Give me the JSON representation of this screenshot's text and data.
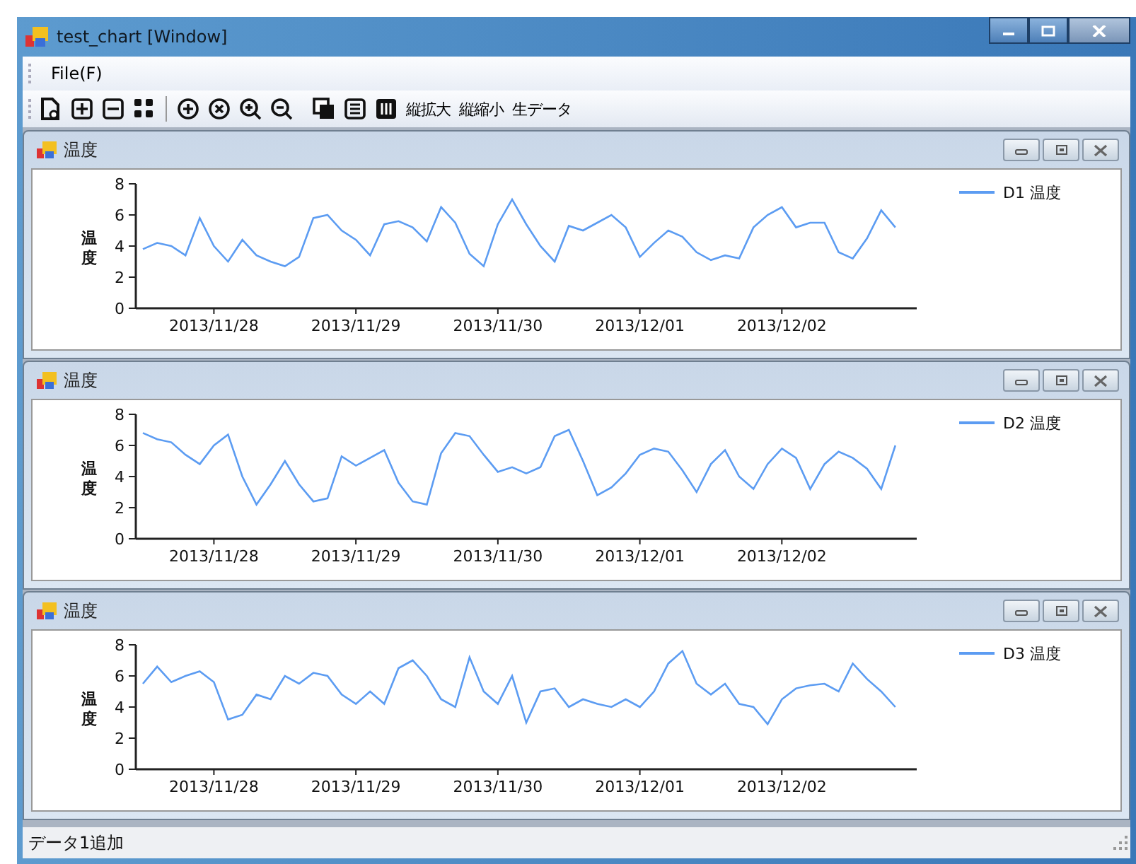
{
  "window": {
    "title": "test_chart [Window]"
  },
  "menu": [
    "File(F)"
  ],
  "toolbar": {
    "text_buttons": [
      "縦拡大",
      "縦縮小",
      "生データ"
    ]
  },
  "panels": [
    {
      "title": "温度",
      "chart_data": {
        "type": "line",
        "ylabel": "温度",
        "ylim": [
          0,
          8
        ],
        "yticks": [
          0,
          2,
          4,
          6,
          8
        ],
        "categories": [
          null,
          null,
          null,
          null,
          null,
          "2013/11/28",
          null,
          null,
          null,
          null,
          null,
          null,
          null,
          null,
          null,
          "2013/11/29",
          null,
          null,
          null,
          null,
          null,
          null,
          null,
          null,
          null,
          "2013/11/30",
          null,
          null,
          null,
          null,
          null,
          null,
          null,
          null,
          null,
          "2013/12/01",
          null,
          null,
          null,
          null,
          null,
          null,
          null,
          null,
          null,
          "2013/12/02",
          null,
          null,
          null,
          null,
          null,
          null,
          null,
          null
        ],
        "series": [
          {
            "name": "D1 温度",
            "color": "#5c9cf2",
            "values": [
              3.8,
              4.2,
              4.0,
              3.4,
              5.8,
              4.0,
              3.0,
              4.4,
              3.4,
              3.0,
              2.7,
              3.3,
              5.8,
              6.0,
              5.0,
              4.4,
              3.4,
              5.4,
              5.6,
              5.2,
              4.3,
              6.5,
              5.5,
              3.5,
              2.7,
              5.4,
              7.0,
              5.4,
              4.0,
              3.0,
              5.3,
              5.0,
              5.5,
              6.0,
              5.2,
              3.3,
              4.2,
              5.0,
              4.6,
              3.6,
              3.1,
              3.4,
              3.2,
              5.2,
              6.0,
              6.5,
              5.2,
              5.5,
              5.5,
              3.6,
              3.2,
              4.5,
              6.3,
              5.2
            ]
          }
        ]
      }
    },
    {
      "title": "温度",
      "chart_data": {
        "type": "line",
        "ylabel": "温度",
        "ylim": [
          0,
          8
        ],
        "yticks": [
          0,
          2,
          4,
          6,
          8
        ],
        "categories": [
          null,
          null,
          null,
          null,
          null,
          "2013/11/28",
          null,
          null,
          null,
          null,
          null,
          null,
          null,
          null,
          null,
          "2013/11/29",
          null,
          null,
          null,
          null,
          null,
          null,
          null,
          null,
          null,
          "2013/11/30",
          null,
          null,
          null,
          null,
          null,
          null,
          null,
          null,
          null,
          "2013/12/01",
          null,
          null,
          null,
          null,
          null,
          null,
          null,
          null,
          null,
          "2013/12/02",
          null,
          null,
          null,
          null,
          null,
          null,
          null,
          null
        ],
        "series": [
          {
            "name": "D2 温度",
            "color": "#5c9cf2",
            "values": [
              6.8,
              6.4,
              6.2,
              5.4,
              4.8,
              6.0,
              6.7,
              4.0,
              2.2,
              3.5,
              5.0,
              3.5,
              2.4,
              2.6,
              5.3,
              4.7,
              5.2,
              5.7,
              3.6,
              2.4,
              2.2,
              5.5,
              6.8,
              6.6,
              5.4,
              4.3,
              4.6,
              4.2,
              4.6,
              6.6,
              7.0,
              5.0,
              2.8,
              3.3,
              4.2,
              5.4,
              5.8,
              5.6,
              4.4,
              3.0,
              4.8,
              5.7,
              4.0,
              3.2,
              4.8,
              5.8,
              5.2,
              3.2,
              4.8,
              5.6,
              5.2,
              4.5,
              3.2,
              6.0
            ]
          }
        ]
      }
    },
    {
      "title": "温度",
      "chart_data": {
        "type": "line",
        "ylabel": "温度",
        "ylim": [
          0,
          8
        ],
        "yticks": [
          0,
          2,
          4,
          6,
          8
        ],
        "categories": [
          null,
          null,
          null,
          null,
          null,
          "2013/11/28",
          null,
          null,
          null,
          null,
          null,
          null,
          null,
          null,
          null,
          "2013/11/29",
          null,
          null,
          null,
          null,
          null,
          null,
          null,
          null,
          null,
          "2013/11/30",
          null,
          null,
          null,
          null,
          null,
          null,
          null,
          null,
          null,
          "2013/12/01",
          null,
          null,
          null,
          null,
          null,
          null,
          null,
          null,
          null,
          "2013/12/02",
          null,
          null,
          null,
          null,
          null,
          null,
          null,
          null
        ],
        "series": [
          {
            "name": "D3 温度",
            "color": "#5c9cf2",
            "values": [
              5.5,
              6.6,
              5.6,
              6.0,
              6.3,
              5.6,
              3.2,
              3.5,
              4.8,
              4.5,
              6.0,
              5.5,
              6.2,
              6.0,
              4.8,
              4.2,
              5.0,
              4.2,
              6.5,
              7.0,
              6.0,
              4.5,
              4.0,
              7.2,
              5.0,
              4.2,
              6.0,
              3.0,
              5.0,
              5.2,
              4.0,
              4.5,
              4.2,
              4.0,
              4.5,
              4.0,
              5.0,
              6.8,
              7.6,
              5.5,
              4.8,
              5.5,
              4.2,
              4.0,
              2.9,
              4.5,
              5.2,
              5.4,
              5.5,
              5.0,
              6.8,
              5.8,
              5.0,
              4.0
            ]
          }
        ]
      }
    }
  ],
  "status_bar": "データ1追加"
}
